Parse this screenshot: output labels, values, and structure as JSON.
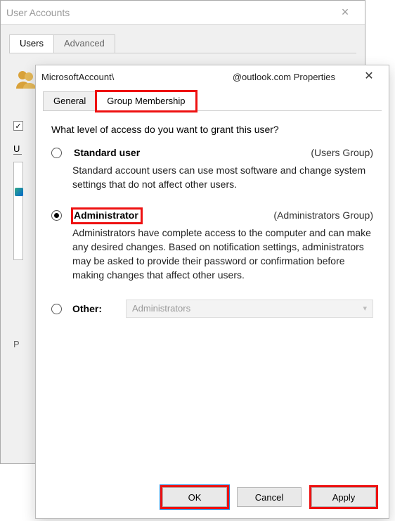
{
  "parent": {
    "title": "User Accounts",
    "tabs": {
      "users": "Users",
      "advanced": "Advanced"
    },
    "users_underline": "U",
    "p_label": "P"
  },
  "child": {
    "title_prefix": "MicrosoftAccount\\",
    "title_suffix": "@outlook.com Properties",
    "tabs": {
      "general": "General",
      "group": "Group Membership"
    },
    "prompt": "What level of access do you want to grant this user?",
    "options": {
      "standard": {
        "title": "Standard user",
        "group": "(Users Group)",
        "desc": "Standard account users can use most software and change system settings that do not affect other users."
      },
      "admin": {
        "title": "Administrator",
        "group": "(Administrators Group)",
        "desc": "Administrators have complete access to the computer and can make any desired changes. Based on notification settings, administrators may be asked to provide their password or confirmation before making changes that affect other users."
      },
      "other": {
        "title": "Other:",
        "select_value": "Administrators"
      }
    },
    "buttons": {
      "ok": "OK",
      "cancel": "Cancel",
      "apply": "Apply"
    }
  }
}
